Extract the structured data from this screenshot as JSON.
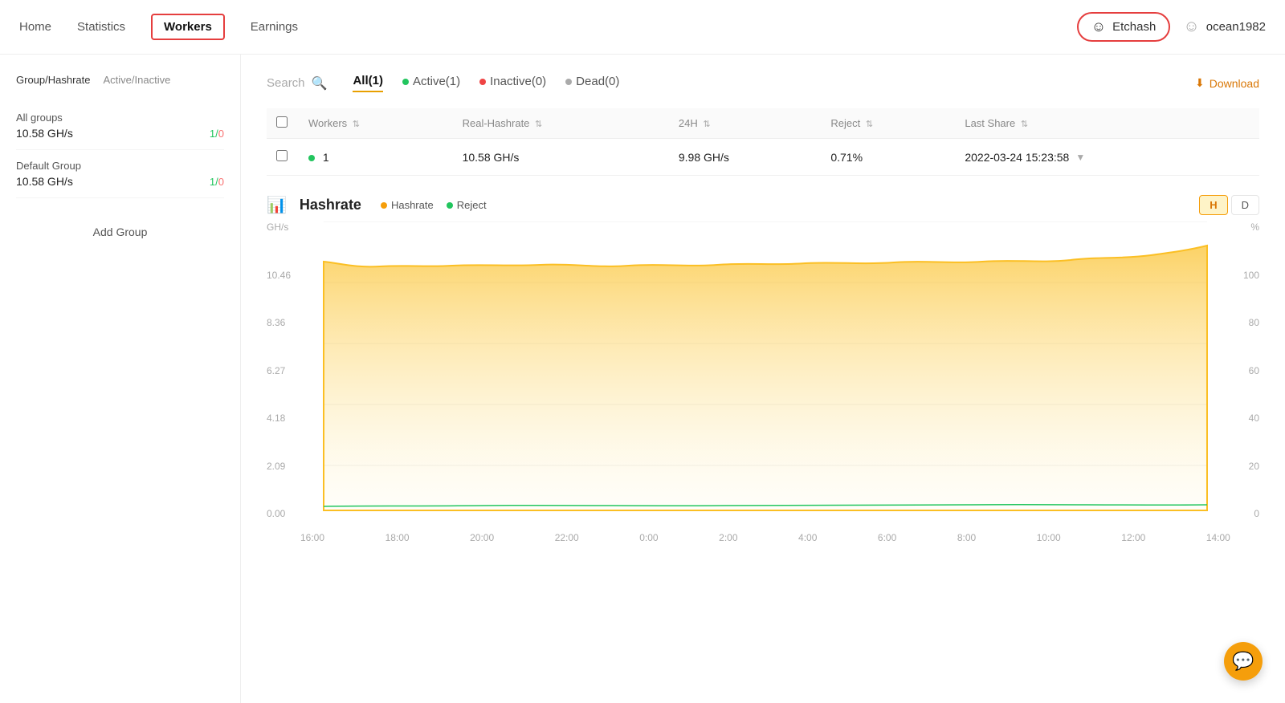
{
  "nav": {
    "items": [
      {
        "label": "Home",
        "id": "home",
        "active": false
      },
      {
        "label": "Statistics",
        "id": "statistics",
        "active": false
      },
      {
        "label": "Workers",
        "id": "workers",
        "active": true
      },
      {
        "label": "Earnings",
        "id": "earnings",
        "active": false
      }
    ],
    "etchash_label": "Etchash",
    "user_label": "ocean1982"
  },
  "sidebar": {
    "tab1": "Group/Hashrate",
    "tab2": "Active/Inactive",
    "groups": [
      {
        "name": "All groups",
        "hashrate": "10.58 GH/s",
        "active": "1",
        "inactive": "0"
      },
      {
        "name": "Default Group",
        "hashrate": "10.58 GH/s",
        "active": "1",
        "inactive": "0"
      }
    ],
    "add_group": "Add Group"
  },
  "filter_bar": {
    "search_placeholder": "Search",
    "tabs": [
      {
        "label": "All(1)",
        "id": "all",
        "active": true
      },
      {
        "label": "Active(1)",
        "id": "active",
        "dot": "green"
      },
      {
        "label": "Inactive(0)",
        "id": "inactive",
        "dot": "red"
      },
      {
        "label": "Dead(0)",
        "id": "dead",
        "dot": "gray"
      }
    ],
    "download_label": "Download"
  },
  "table": {
    "columns": [
      "",
      "Workers",
      "Real-Hashrate",
      "24H",
      "Reject",
      "Last Share"
    ],
    "rows": [
      {
        "worker": "1",
        "real_hashrate": "10.58 GH/s",
        "h24": "9.98 GH/s",
        "reject": "0.71%",
        "last_share": "2022-03-24 15:23:58"
      }
    ]
  },
  "chart": {
    "title": "Hashrate",
    "legend": [
      {
        "label": "Hashrate",
        "color": "yellow"
      },
      {
        "label": "Reject",
        "color": "green"
      }
    ],
    "controls": [
      "H",
      "D"
    ],
    "active_control": "H",
    "y_labels_left": [
      "10.46",
      "8.36",
      "6.27",
      "4.18",
      "2.09",
      "0.00"
    ],
    "y_labels_right": [
      "100",
      "80",
      "60",
      "40",
      "20",
      "0"
    ],
    "y_unit_left": "GH/s",
    "y_unit_right": "%",
    "x_labels": [
      "16:00",
      "18:00",
      "20:00",
      "22:00",
      "0:00",
      "2:00",
      "4:00",
      "6:00",
      "8:00",
      "10:00",
      "12:00",
      "14:00"
    ]
  },
  "chat": {
    "icon": "💬"
  }
}
